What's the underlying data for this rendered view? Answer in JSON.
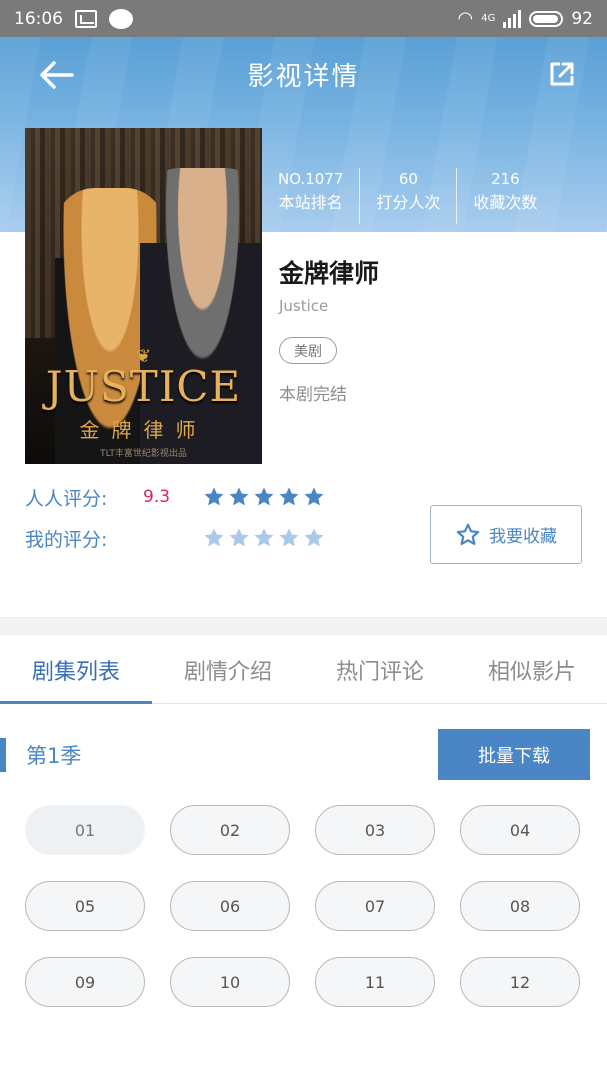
{
  "status_bar": {
    "time": "16:06",
    "network": "4G",
    "battery": "92"
  },
  "header": {
    "title": "影视详情"
  },
  "poster": {
    "ornament": "❦",
    "title": "JUSTICE",
    "cn_title": "金牌律师",
    "small_text": "TLT丰富世纪影视出品"
  },
  "stats": [
    {
      "value": "NO.1077",
      "label": "本站排名"
    },
    {
      "value": "60",
      "label": "打分人次"
    },
    {
      "value": "216",
      "label": "收藏次数"
    }
  ],
  "show": {
    "title": "金牌律师",
    "english_title": "Justice",
    "genre": "美剧",
    "status": "本剧完结"
  },
  "ratings": {
    "community_label": "人人评分:",
    "community_score": "9.3",
    "community_stars": 5,
    "my_label": "我的评分:",
    "my_stars": 0
  },
  "collect_button": {
    "label": "我要收藏",
    "icon": "star-outline-icon"
  },
  "tabs": [
    {
      "label": "剧集列表",
      "active": true
    },
    {
      "label": "剧情介绍",
      "active": false
    },
    {
      "label": "热门评论",
      "active": false
    },
    {
      "label": "相似影片",
      "active": false
    }
  ],
  "season": {
    "label": "第1季",
    "batch_download": "批量下载"
  },
  "episodes": [
    "01",
    "02",
    "03",
    "04",
    "05",
    "06",
    "07",
    "08",
    "09",
    "10",
    "11",
    "12"
  ],
  "colors": {
    "accent": "#4a86c6",
    "score": "#d8236a",
    "star_filled": "#4a86c6",
    "star_empty": "#a9c8ea"
  }
}
